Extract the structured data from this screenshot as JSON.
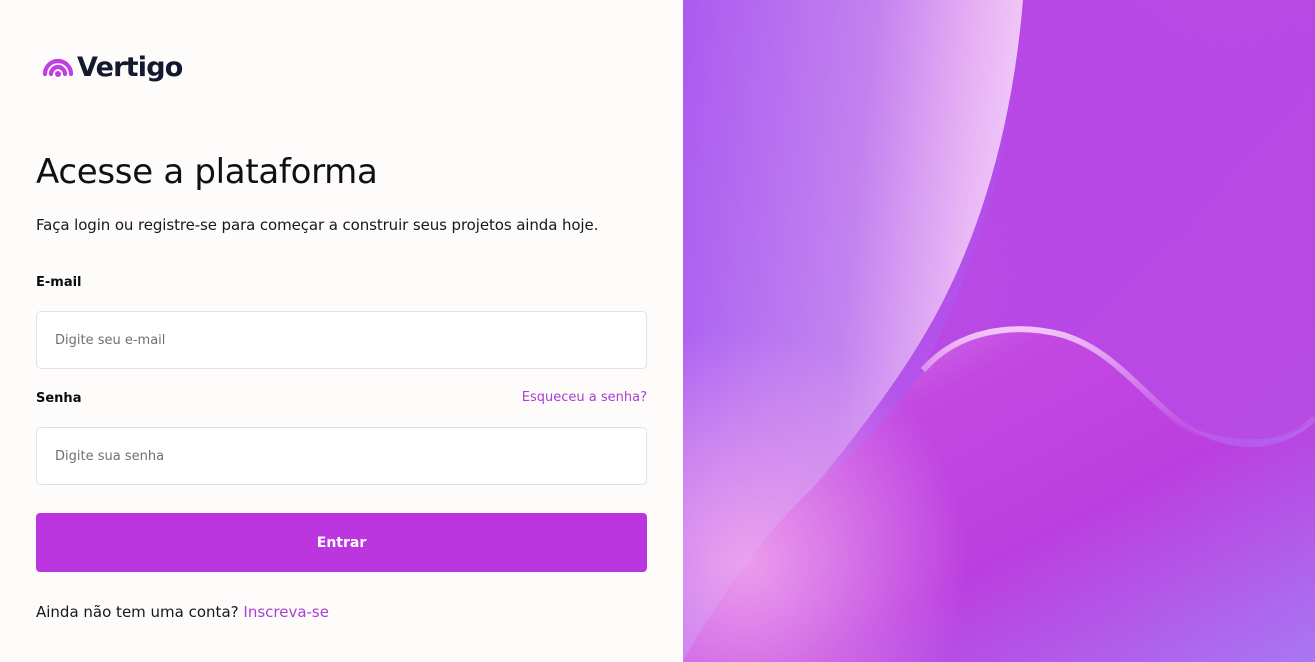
{
  "brand": {
    "name": "Vertigo",
    "accent_color": "#bc36e0",
    "logo_icon": "vertigo-wifi-logo-icon"
  },
  "login": {
    "title": "Acesse a plataforma",
    "subtitle": "Faça login ou registre-se para começar a construir seus projetos ainda hoje.",
    "email": {
      "label": "E-mail",
      "placeholder": "Digite seu e-mail",
      "value": ""
    },
    "password": {
      "label": "Senha",
      "placeholder": "Digite sua senha",
      "value": "",
      "forgot_link": "Esqueceu a senha?"
    },
    "submit_label": "Entrar",
    "signup_prompt": "Ainda não tem uma conta?",
    "signup_link": "Inscreva-se"
  },
  "hero": {
    "description_icon": "abstract-purple-waves-background",
    "colors": [
      "#b93fe2",
      "#a45ff0",
      "#e6a0f2",
      "#c24fe0"
    ]
  }
}
